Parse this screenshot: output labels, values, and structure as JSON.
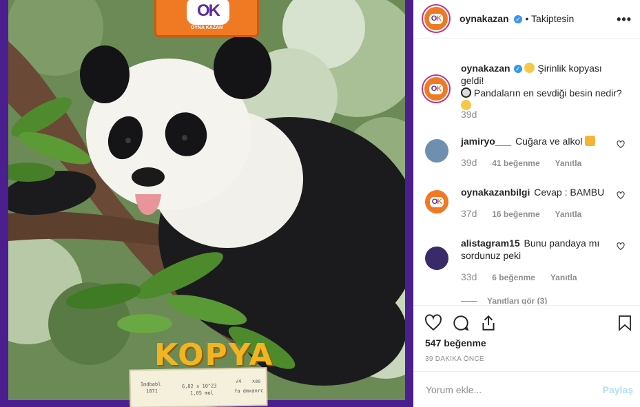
{
  "media": {
    "badge_text": "OK",
    "badge_subtext": "OYNA KAZAN",
    "banner_word": "KOPYA",
    "doodles": [
      "İmdbabl",
      "1071",
      "6,02 x 10^23",
      "1,05 mol",
      "√4",
      "xas",
      "fa dmxanrc"
    ]
  },
  "header": {
    "username": "oynakazan",
    "follow_status": "• Takiptesin"
  },
  "caption": {
    "username": "oynakazan",
    "text_line1": "Şirinlik kopyası geldi!",
    "text_line2": "Pandaların en sevdiği besin nedir?",
    "time": "39d"
  },
  "comments": [
    {
      "username": "jamiryo___",
      "text": "Cuğara ve alkol",
      "time": "39d",
      "likes": "41 beğenme",
      "reply": "Yanıtla"
    },
    {
      "username": "oynakazanbilgi",
      "text": "Cevap : BAMBU",
      "time": "37d",
      "likes": "16 beğenme",
      "reply": "Yanıtla"
    },
    {
      "username": "alistagram15",
      "text": "Bunu pandaya mı sordunuz peki",
      "time": "33d",
      "likes": "6 beğenme",
      "reply": "Yanıtla"
    }
  ],
  "view_replies": "Yanıtları gör (3)",
  "post": {
    "likes": "547 beğenme",
    "time_ago": "39 DAKİKA ÖNCE"
  },
  "comment_box": {
    "placeholder": "Yorum ekle...",
    "share_label": "Paylaş"
  },
  "colors": {
    "brand_orange": "#f07a23",
    "brand_purple": "#5a2aa0",
    "verified_blue": "#3897f0",
    "muted": "#8e8e8e"
  }
}
